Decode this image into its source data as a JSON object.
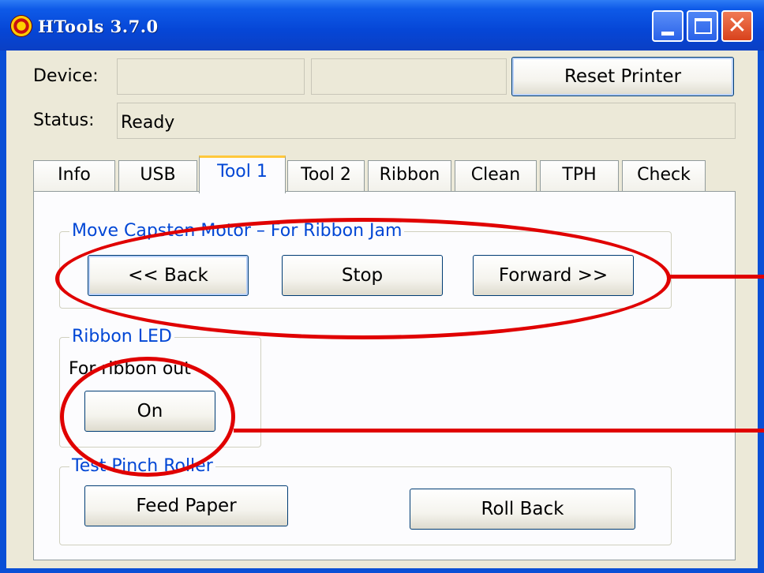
{
  "window": {
    "title": "HTools  3.7.0"
  },
  "header": {
    "device_label": "Device:",
    "device_value_1": "",
    "device_value_2": "",
    "reset_button": "Reset Printer",
    "status_label": "Status:",
    "status_value": "Ready"
  },
  "tabs": [
    "Info",
    "USB",
    "Tool 1",
    "Tool 2",
    "Ribbon",
    "Clean",
    "TPH",
    "Check"
  ],
  "active_tab": "Tool 1",
  "tool1": {
    "capstan_group": {
      "title": "Move Capsten Motor – For Ribbon Jam",
      "back": "<< Back",
      "stop": "Stop",
      "forward": "Forward >>"
    },
    "ribbon_led_group": {
      "title": "Ribbon LED",
      "note": "For ribbon out",
      "on": "On"
    },
    "pinch_group": {
      "title": "Test Pinch Roller",
      "feed": "Feed Paper",
      "rollback": "Roll Back"
    }
  },
  "colors": {
    "titlebar": "#0646d6",
    "accent_text": "#0046d5",
    "annotation": "#e00000",
    "tab_highlight": "#ffc83c"
  }
}
